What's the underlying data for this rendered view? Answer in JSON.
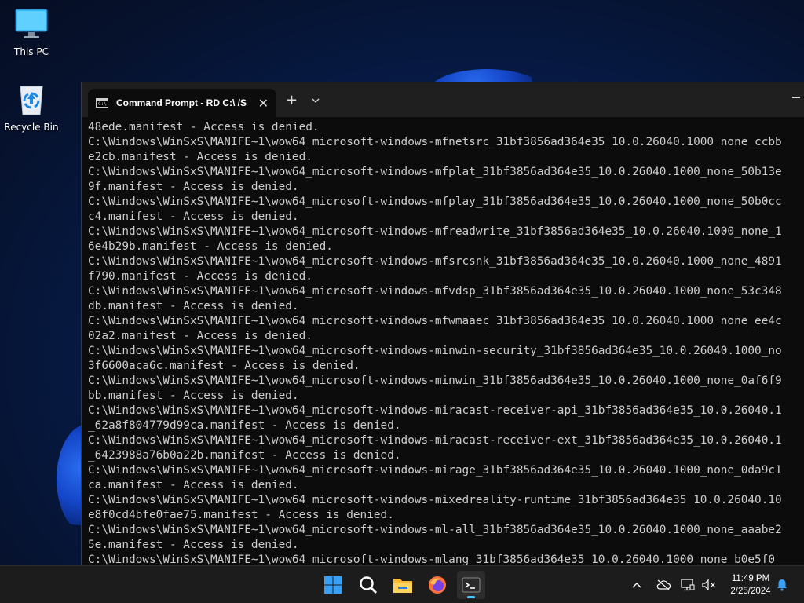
{
  "desktop": {
    "icons": [
      {
        "label": "This PC"
      },
      {
        "label": "Recycle Bin"
      }
    ]
  },
  "window": {
    "tab_title": "Command Prompt - RD  C:\\ /S",
    "tab_icon_text": "C:\\.",
    "new_tab": "+",
    "tab_menu": "⌄"
  },
  "console": {
    "lines": [
      "48ede.manifest - Access is denied.",
      "C:\\Windows\\WinSxS\\MANIFE~1\\wow64_microsoft-windows-mfnetsrc_31bf3856ad364e35_10.0.26040.1000_none_ccbb",
      "e2cb.manifest - Access is denied.",
      "C:\\Windows\\WinSxS\\MANIFE~1\\wow64_microsoft-windows-mfplat_31bf3856ad364e35_10.0.26040.1000_none_50b13e",
      "9f.manifest - Access is denied.",
      "C:\\Windows\\WinSxS\\MANIFE~1\\wow64_microsoft-windows-mfplay_31bf3856ad364e35_10.0.26040.1000_none_50b0cc",
      "c4.manifest - Access is denied.",
      "C:\\Windows\\WinSxS\\MANIFE~1\\wow64_microsoft-windows-mfreadwrite_31bf3856ad364e35_10.0.26040.1000_none_1",
      "6e4b29b.manifest - Access is denied.",
      "C:\\Windows\\WinSxS\\MANIFE~1\\wow64_microsoft-windows-mfsrcsnk_31bf3856ad364e35_10.0.26040.1000_none_4891",
      "f790.manifest - Access is denied.",
      "C:\\Windows\\WinSxS\\MANIFE~1\\wow64_microsoft-windows-mfvdsp_31bf3856ad364e35_10.0.26040.1000_none_53c348",
      "db.manifest - Access is denied.",
      "C:\\Windows\\WinSxS\\MANIFE~1\\wow64_microsoft-windows-mfwmaaec_31bf3856ad364e35_10.0.26040.1000_none_ee4c",
      "02a2.manifest - Access is denied.",
      "C:\\Windows\\WinSxS\\MANIFE~1\\wow64_microsoft-windows-minwin-security_31bf3856ad364e35_10.0.26040.1000_no",
      "3f6600aca6c.manifest - Access is denied.",
      "C:\\Windows\\WinSxS\\MANIFE~1\\wow64_microsoft-windows-minwin_31bf3856ad364e35_10.0.26040.1000_none_0af6f9",
      "bb.manifest - Access is denied.",
      "C:\\Windows\\WinSxS\\MANIFE~1\\wow64_microsoft-windows-miracast-receiver-api_31bf3856ad364e35_10.0.26040.1",
      "_62a8f804779d99ca.manifest - Access is denied.",
      "C:\\Windows\\WinSxS\\MANIFE~1\\wow64_microsoft-windows-miracast-receiver-ext_31bf3856ad364e35_10.0.26040.1",
      "_6423988a76b0a22b.manifest - Access is denied.",
      "C:\\Windows\\WinSxS\\MANIFE~1\\wow64_microsoft-windows-mirage_31bf3856ad364e35_10.0.26040.1000_none_0da9c1",
      "ca.manifest - Access is denied.",
      "C:\\Windows\\WinSxS\\MANIFE~1\\wow64_microsoft-windows-mixedreality-runtime_31bf3856ad364e35_10.0.26040.10",
      "e8f0cd4bfe0fae75.manifest - Access is denied.",
      "C:\\Windows\\WinSxS\\MANIFE~1\\wow64_microsoft-windows-ml-all_31bf3856ad364e35_10.0.26040.1000_none_aaabe2",
      "5e.manifest - Access is denied.",
      "C:\\Windows\\WinSxS\\MANIFE~1\\wow64_microsoft-windows-mlang_31bf3856ad364e35_10.0.26040.1000_none_b0e5f0"
    ]
  },
  "taskbar": {
    "apps": [
      {
        "name": "start"
      },
      {
        "name": "search"
      },
      {
        "name": "file-explorer"
      },
      {
        "name": "firefox"
      },
      {
        "name": "terminal",
        "active": true
      }
    ],
    "clock": {
      "time": "11:49 PM",
      "date": "2/25/2024"
    }
  }
}
